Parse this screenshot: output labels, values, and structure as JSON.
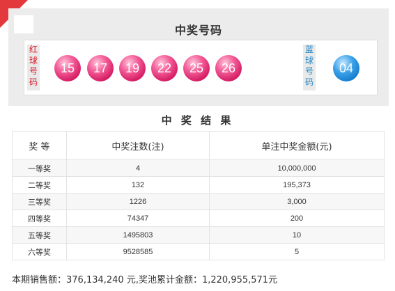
{
  "panel": {
    "title": "中奖号码",
    "red_label": "红球号码",
    "blue_label": "蓝球号码",
    "red_balls": [
      "15",
      "17",
      "19",
      "22",
      "25",
      "26"
    ],
    "blue_balls": [
      "04"
    ]
  },
  "results": {
    "title": "中 奖 结 果",
    "headers": [
      "奖  等",
      "中奖注数(注)",
      "单注中奖金额(元)"
    ],
    "rows": [
      {
        "level": "一等奖",
        "count": "4",
        "amount": "10,000,000"
      },
      {
        "level": "二等奖",
        "count": "132",
        "amount": "195,373"
      },
      {
        "level": "三等奖",
        "count": "1226",
        "amount": "3,000"
      },
      {
        "level": "四等奖",
        "count": "74347",
        "amount": "200"
      },
      {
        "level": "五等奖",
        "count": "1495803",
        "amount": "10"
      },
      {
        "level": "六等奖",
        "count": "9528585",
        "amount": "5"
      }
    ]
  },
  "summary": {
    "text": "本期销售额：376,134,240 元,奖池累计金额：1,220,955,571元"
  },
  "colors": {
    "accent_red": "#e4393c",
    "red_ball": "#e22a72",
    "blue_ball": "#1e88c7"
  }
}
